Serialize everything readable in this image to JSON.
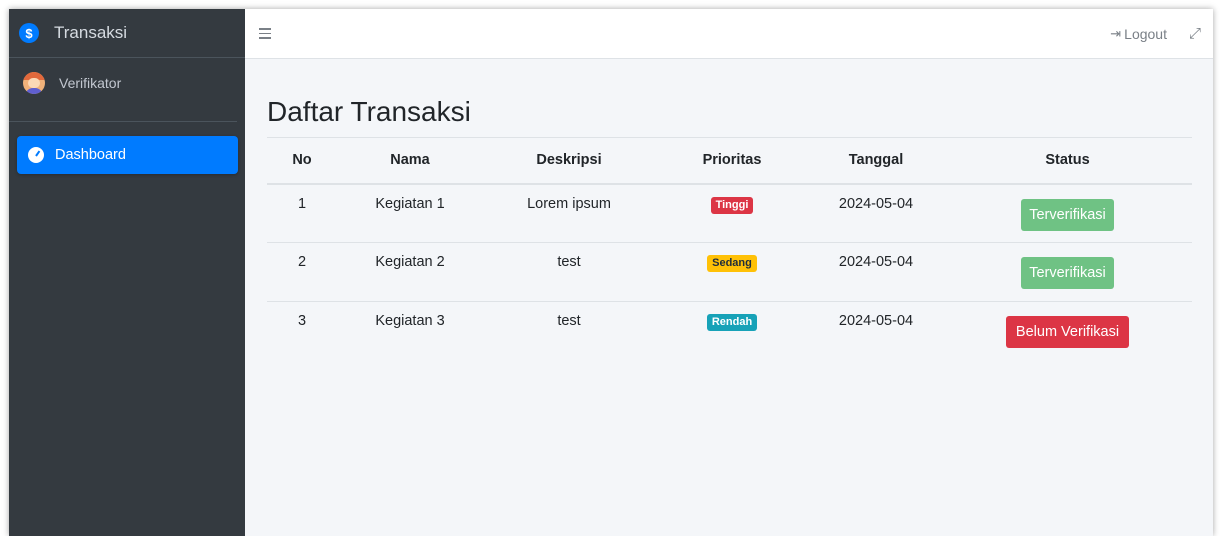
{
  "sidebar": {
    "brand": {
      "icon": "$",
      "title": "Transaksi"
    },
    "user": {
      "name": "Verifikator"
    },
    "nav": [
      {
        "label": "Dashboard",
        "icon": "tachometer-icon",
        "active": true
      }
    ]
  },
  "topbar": {
    "menu_icon": "hamburger-icon",
    "logout_label": "Logout",
    "logout_icon": "sign-out-icon",
    "fullscreen_icon": "expand-icon"
  },
  "page": {
    "title": "Daftar Transaksi",
    "table": {
      "headers": [
        "No",
        "Nama",
        "Deskripsi",
        "Prioritas",
        "Tanggal",
        "Status"
      ],
      "rows": [
        {
          "no": "1",
          "nama": "Kegiatan 1",
          "deskripsi": "Lorem ipsum",
          "prioritas": "Tinggi",
          "tanggal": "2024-05-04",
          "status": "Terverifikasi"
        },
        {
          "no": "2",
          "nama": "Kegiatan 2",
          "deskripsi": "test",
          "prioritas": "Sedang",
          "tanggal": "2024-05-04",
          "status": "Terverifikasi"
        },
        {
          "no": "3",
          "nama": "Kegiatan 3",
          "deskripsi": "test",
          "prioritas": "Rendah",
          "tanggal": "2024-05-04",
          "status": "Belum Verifikasi"
        }
      ]
    }
  },
  "colors": {
    "sidebar_bg": "#343a40",
    "primary": "#007bff",
    "success": "#6fc284",
    "danger": "#dc3545",
    "warning": "#ffc107",
    "info": "#17a2b8"
  }
}
